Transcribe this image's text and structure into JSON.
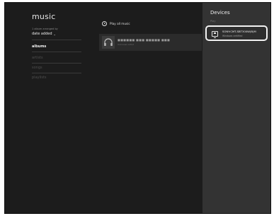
{
  "app": {
    "title": "music"
  },
  "sort": {
    "caption": "1 album arranged by",
    "value": "date added"
  },
  "nav": {
    "items": [
      {
        "label": "albums"
      },
      {
        "label": "artists"
      },
      {
        "label": "songs"
      },
      {
        "label": "playlists"
      }
    ]
  },
  "main": {
    "play_all_label": "Play all music",
    "album": {
      "title": "■■■■■■ ■■■ ■■■■■ ■■■",
      "artist": "Unknown Artist"
    }
  },
  "devices": {
    "title": "Devices",
    "subtitle": "Play",
    "items": [
      {
        "name": "SONY:CMT-SBT300W(B)M",
        "status": "Windows certified"
      }
    ]
  }
}
